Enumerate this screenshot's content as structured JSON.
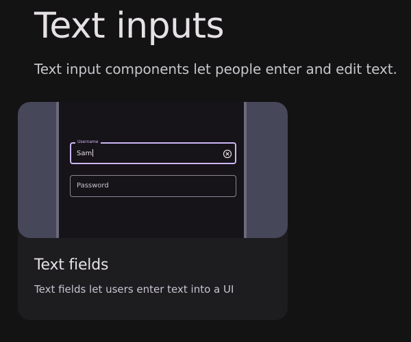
{
  "page": {
    "title": "Text inputs",
    "subtitle": "Text input components let people enter and edit text."
  },
  "card": {
    "title": "Text fields",
    "description": "Text fields let users enter text into a UI",
    "preview": {
      "username_field": {
        "label": "Username",
        "value": "Sam",
        "trailing_icon": "clear-icon"
      },
      "password_field": {
        "placeholder": "Password"
      }
    }
  },
  "colors": {
    "background": "#131314",
    "card_background": "#1d1d20",
    "preview_frame": "#47475a",
    "preview_screen": "#161319",
    "focused_outline": "#cdb6f5"
  }
}
